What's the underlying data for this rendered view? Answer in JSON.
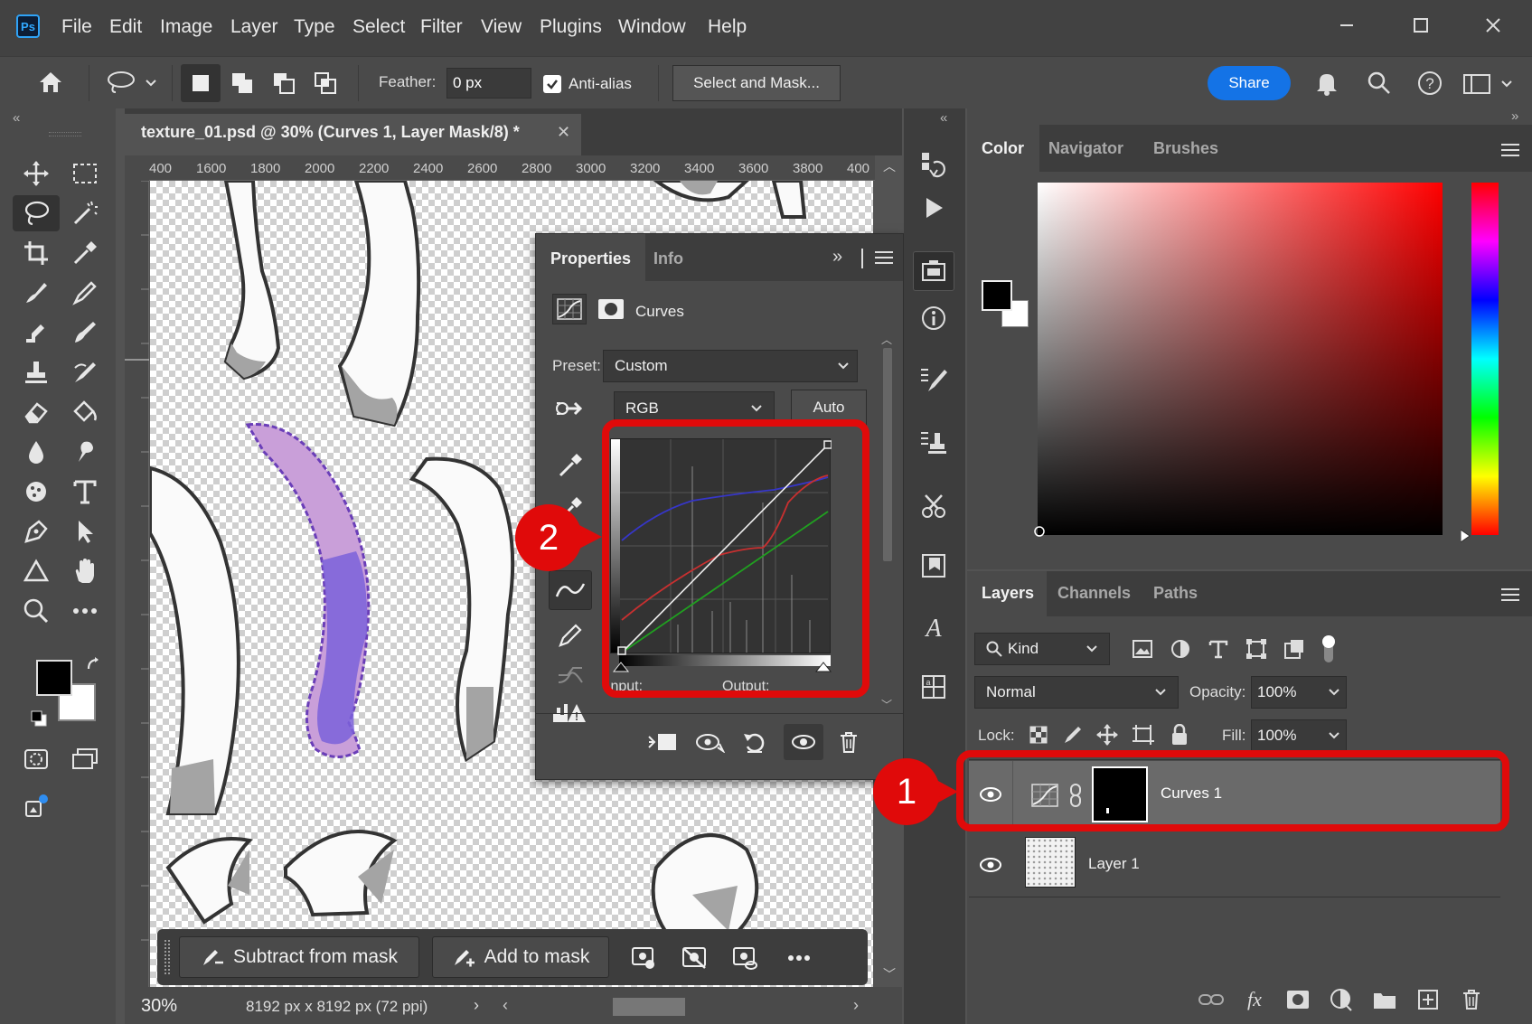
{
  "app": {
    "logo": "Ps",
    "menu": [
      "File",
      "Edit",
      "Image",
      "Layer",
      "Type",
      "Select",
      "Filter",
      "View",
      "Plugins",
      "Window",
      "Help"
    ]
  },
  "options": {
    "feather_label": "Feather:",
    "feather_value": "0 px",
    "antialias_label": "Anti-alias",
    "antialias_checked": true,
    "select_mask": "Select and Mask...",
    "share": "Share"
  },
  "document": {
    "tab_title": "texture_01.psd @ 30% (Curves 1, Layer Mask/8) *",
    "ruler_ticks": [
      "400",
      "1600",
      "1800",
      "2000",
      "2200",
      "2400",
      "2600",
      "2800",
      "3000",
      "3200",
      "3400",
      "3600",
      "3800",
      "400"
    ],
    "zoom": "30%",
    "doc_info": "8192 px x 8192 px (72 ppi)"
  },
  "mask_toolbar": {
    "subtract": "Subtract from mask",
    "add": "Add to mask"
  },
  "properties": {
    "tabs": [
      "Properties",
      "Info"
    ],
    "adjustment": "Curves",
    "preset_label": "Preset:",
    "preset_value": "Custom",
    "channel": "RGB",
    "auto": "Auto",
    "input_label": "Input:",
    "output_label": "Output:"
  },
  "color_panel": {
    "tabs": [
      "Color",
      "Navigator",
      "Brushes"
    ]
  },
  "layers_panel": {
    "tabs": [
      "Layers",
      "Channels",
      "Paths"
    ],
    "filter_kind": "Kind",
    "blend_mode": "Normal",
    "opacity_label": "Opacity:",
    "opacity_value": "100%",
    "lock_label": "Lock:",
    "fill_label": "Fill:",
    "fill_value": "100%",
    "layers": [
      {
        "name": "Curves 1",
        "selected": true
      },
      {
        "name": "Layer 1",
        "selected": false
      }
    ]
  },
  "callouts": [
    "1",
    "2"
  ],
  "colors": {
    "highlight": "#e00a0a",
    "share": "#1473e6",
    "selection_fill": "#c89fd7",
    "curve_red": "#d03030",
    "curve_green": "#22aa22",
    "curve_blue": "#3030c0"
  }
}
